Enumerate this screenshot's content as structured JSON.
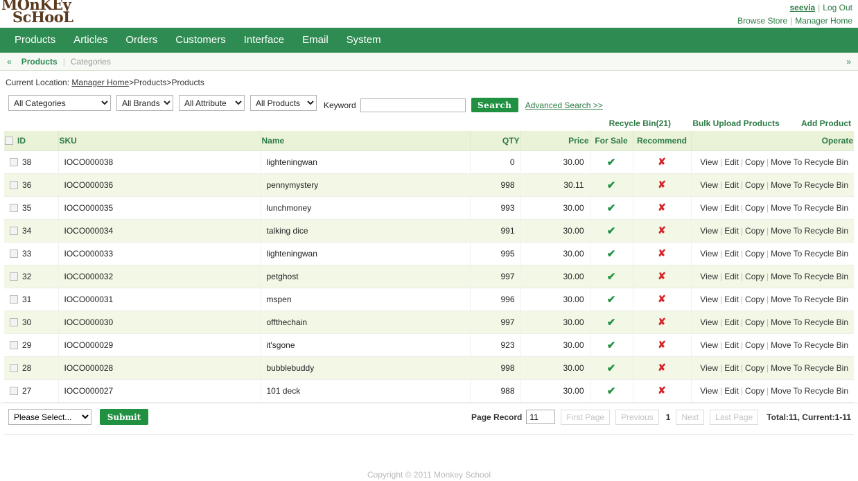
{
  "brand": {
    "line1": "MOnKEy",
    "line2": "ScHooL"
  },
  "user": {
    "name": "seevia",
    "logout": "Log Out",
    "browse_store": "Browse Store",
    "manager_home": "Manager Home",
    "separator": "|"
  },
  "mainnav": [
    {
      "label": "Products"
    },
    {
      "label": "Articles"
    },
    {
      "label": "Orders"
    },
    {
      "label": "Customers"
    },
    {
      "label": "Interface"
    },
    {
      "label": "Email"
    },
    {
      "label": "System"
    }
  ],
  "subnav": {
    "left_arrow": "«",
    "right_arrow": "»",
    "tabs": [
      {
        "label": "Products",
        "active": true
      },
      {
        "label": "Categories",
        "active": false
      }
    ],
    "divider": "|"
  },
  "location": {
    "label": "Current Location:",
    "root": "Manager Home",
    "trail": ">Products>Products"
  },
  "search": {
    "category": "All Categories",
    "brand": "All Brands",
    "attribute": "All Attribute",
    "product": "All Products",
    "keyword_label": "Keyword",
    "keyword_value": "",
    "keyword_placeholder": "",
    "search_button": "Search",
    "advanced": "Advanced Search >>"
  },
  "actions": {
    "recycle_bin": "Recycle Bin(21)",
    "bulk_upload": "Bulk Upload Products",
    "add_product": "Add Product"
  },
  "table": {
    "columns": [
      "ID",
      "SKU",
      "Name",
      "QTY",
      "Price",
      "For Sale",
      "Recommend",
      "Operate"
    ],
    "ops": {
      "view": "View",
      "edit": "Edit",
      "copy": "Copy",
      "move": "Move To Recycle Bin",
      "bar": "|"
    },
    "icons": {
      "yes": "✔",
      "no": "✘"
    },
    "rows": [
      {
        "id": "38",
        "sku": "IOCO000038",
        "name": "lighteningwan",
        "qty": "0",
        "price": "30.00",
        "for_sale": true,
        "recommend": false
      },
      {
        "id": "36",
        "sku": "IOCO000036",
        "name": "pennymystery",
        "qty": "998",
        "price": "30.11",
        "for_sale": true,
        "recommend": false
      },
      {
        "id": "35",
        "sku": "IOCO000035",
        "name": "lunchmoney",
        "qty": "993",
        "price": "30.00",
        "for_sale": true,
        "recommend": false
      },
      {
        "id": "34",
        "sku": "IOCO000034",
        "name": "talking dice",
        "qty": "991",
        "price": "30.00",
        "for_sale": true,
        "recommend": false
      },
      {
        "id": "33",
        "sku": "IOCO000033",
        "name": "lighteningwan",
        "qty": "995",
        "price": "30.00",
        "for_sale": true,
        "recommend": false
      },
      {
        "id": "32",
        "sku": "IOCO000032",
        "name": "petghost",
        "qty": "997",
        "price": "30.00",
        "for_sale": true,
        "recommend": false
      },
      {
        "id": "31",
        "sku": "IOCO000031",
        "name": "mspen",
        "qty": "996",
        "price": "30.00",
        "for_sale": true,
        "recommend": false
      },
      {
        "id": "30",
        "sku": "IOCO000030",
        "name": "offthechain",
        "qty": "997",
        "price": "30.00",
        "for_sale": true,
        "recommend": false
      },
      {
        "id": "29",
        "sku": "IOCO000029",
        "name": "it'sgone",
        "qty": "923",
        "price": "30.00",
        "for_sale": true,
        "recommend": false
      },
      {
        "id": "28",
        "sku": "IOCO000028",
        "name": "bubblebuddy",
        "qty": "998",
        "price": "30.00",
        "for_sale": true,
        "recommend": false
      },
      {
        "id": "27",
        "sku": "IOCO000027",
        "name": "101 deck",
        "qty": "988",
        "price": "30.00",
        "for_sale": true,
        "recommend": false
      }
    ]
  },
  "bottom": {
    "batch_select": "Please Select...",
    "submit": "Submit",
    "page_record_label": "Page Record",
    "page_record_value": "11",
    "first_page": "First Page",
    "previous": "Previous",
    "current_page": "1",
    "next": "Next",
    "last_page": "Last Page",
    "total": "Total:11, Current:1-11"
  },
  "footer": {
    "copyright": "Copyright © 2011 Monkey School"
  },
  "colors": {
    "nav_green": "#2e8b52",
    "accent_green": "#2b7a43",
    "header_row": "#eaf3d8",
    "alt_row": "#f2f7e6",
    "tick_green": "#1f9141",
    "cross_red": "#d6252a",
    "logo_brown": "#5b3a1e"
  }
}
